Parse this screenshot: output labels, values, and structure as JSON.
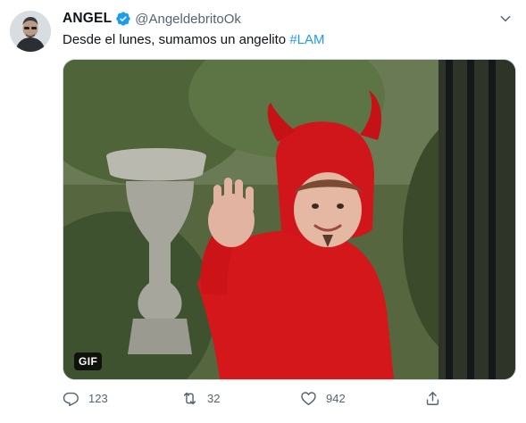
{
  "tweet": {
    "author_name": "ANGEL",
    "author_handle": "@AngeldebritoOk",
    "verified": true,
    "text": "Desde el lunes, sumamos un angelito ",
    "hashtag": "#LAM",
    "media_badge": "GIF",
    "replies": "123",
    "retweets": "32",
    "likes": "942"
  },
  "colors": {
    "accent": "#1d9bf0",
    "secondary_text": "#536471",
    "primary_text": "#0f1419"
  },
  "icons": {
    "verified": "verified-badge-icon",
    "more": "chevron-down-icon",
    "reply": "reply-icon",
    "retweet": "retweet-icon",
    "like": "heart-icon",
    "share": "share-icon"
  }
}
